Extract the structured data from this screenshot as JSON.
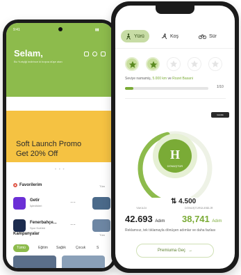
{
  "left_phone": {
    "status": {
      "time": "9:41"
    },
    "greeting": "Selam,",
    "greeting_sub": "Bu Yurtçiği indirince ki boşna düşe atan",
    "promo": {
      "line1": "Soft Launch Promo",
      "line2": "Get 20% Off"
    },
    "favorites": {
      "title": "Favorilerim",
      "see_all": "Tüm",
      "items": [
        {
          "name": "Getir",
          "sub": "İşlevlikleri",
          "color": "#6b2fd6",
          "icon": "getir-logo"
        },
        {
          "name": "Fenerbahçe...",
          "sub": "Spor Kulübü",
          "color": "#1c2b4e",
          "icon": "fenerbahce-logo"
        }
      ]
    },
    "campaigns": {
      "title": "Kampanyalar",
      "see_all": "Tüm",
      "chips": [
        "Tümü",
        "Eğitim",
        "Sağlık",
        "Çocuk",
        "S"
      ]
    }
  },
  "right_phone": {
    "tabs": [
      {
        "label": "Yürü",
        "icon": "walk-icon",
        "active": true
      },
      {
        "label": "Koş",
        "icon": "run-icon",
        "active": false
      },
      {
        "label": "Sür",
        "icon": "bike-icon",
        "active": false
      }
    ],
    "badges": [
      true,
      true,
      false,
      false,
      false
    ],
    "goal_text_prefix": "Seviye namamiş,",
    "goal_text_highlight": "5.000 km",
    "goal_text_suffix": "ve",
    "goal_text_end": "Rozet Basani",
    "goal_progress": 0.1,
    "goal_count": "1/10",
    "pill_label": "Günlük",
    "logo_letter": "H",
    "logo_caption": "DÖNÜŞTÜR",
    "ring_progress": 0.55,
    "steps": "4.500",
    "left_stat": {
      "label": "YAKILDI",
      "value": "42.693",
      "unit": "Adım",
      "color": "#222222"
    },
    "right_stat": {
      "label": "DÖNÜŞTÜRÜLEBİLİR",
      "value": "38,741",
      "unit": "Adım",
      "color": "#7aab36"
    },
    "note": "Reklamsız, tek tıklamayla dönüşen adımlar ve daha fazlası",
    "premium_button": "Premiuma Geç"
  },
  "colors": {
    "accent": "#8dbb4c",
    "promo": "#f5c242"
  }
}
